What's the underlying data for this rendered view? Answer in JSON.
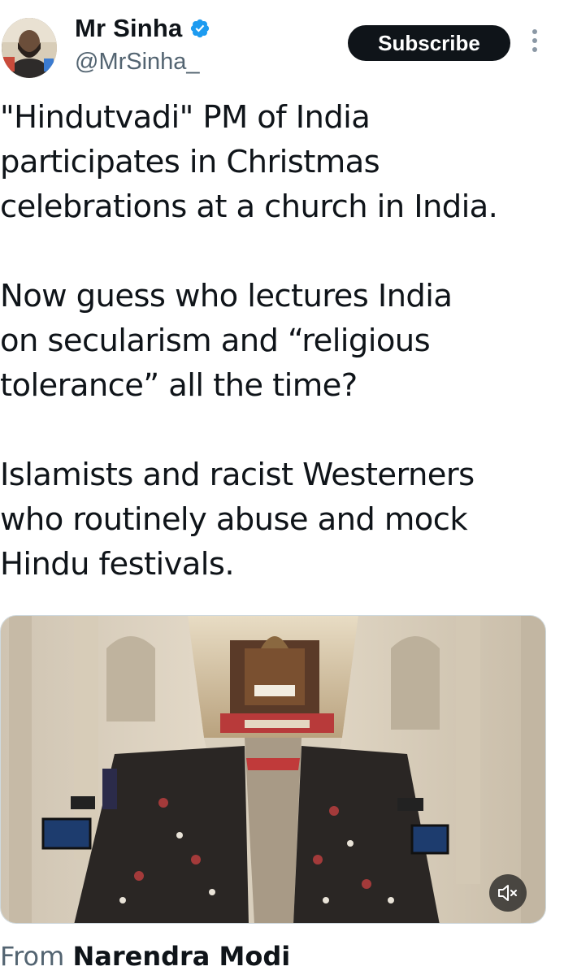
{
  "author": {
    "display_name": "Mr Sinha",
    "handle": "@MrSinha_",
    "verified": true,
    "avatar_icon": "profile-photo"
  },
  "header": {
    "subscribe_label": "Subscribe",
    "more_icon": "more-vertical-icon"
  },
  "tweet": {
    "text": "\"Hindutvadi\" PM of India\nparticipates in Christmas\ncelebrations at a church in India.\n\nNow guess who lectures India\non secularism and “religious\ntolerance” all the time?\n\nIslamists and racist Westerners\nwho routinely abuse and mock\nHindu festivals."
  },
  "media": {
    "type": "video",
    "subject": "church-interior-christmas-service",
    "mute_icon": "volume-muted-icon"
  },
  "source": {
    "from_label": "From",
    "name": "Narendra Modi"
  },
  "colors": {
    "text": "#0f1419",
    "secondary": "#536471",
    "verified": "#1d9bf0",
    "button_bg": "#0f1419"
  }
}
